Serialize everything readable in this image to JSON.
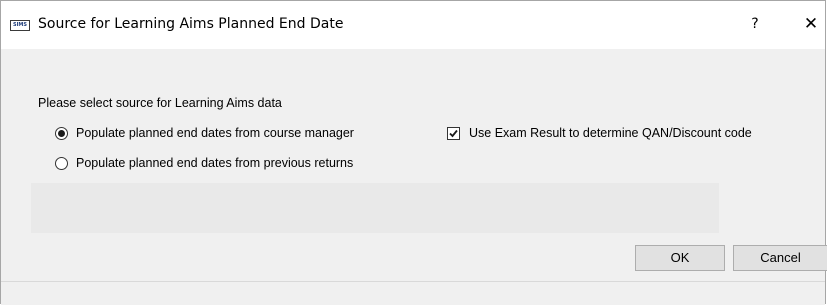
{
  "window": {
    "app_icon_text": "SIMS",
    "title": "Source for Learning Aims Planned End Date",
    "help_label": "?",
    "close_label": "✕"
  },
  "form": {
    "prompt": "Please select source for Learning Aims data",
    "options": [
      {
        "label": "Populate planned end dates from course manager",
        "selected": true
      },
      {
        "label": "Populate planned end dates from previous returns",
        "selected": false
      }
    ],
    "checkbox": {
      "label": "Use Exam Result to determine QAN/Discount code",
      "checked": true
    }
  },
  "buttons": {
    "ok": "OK",
    "cancel": "Cancel"
  }
}
